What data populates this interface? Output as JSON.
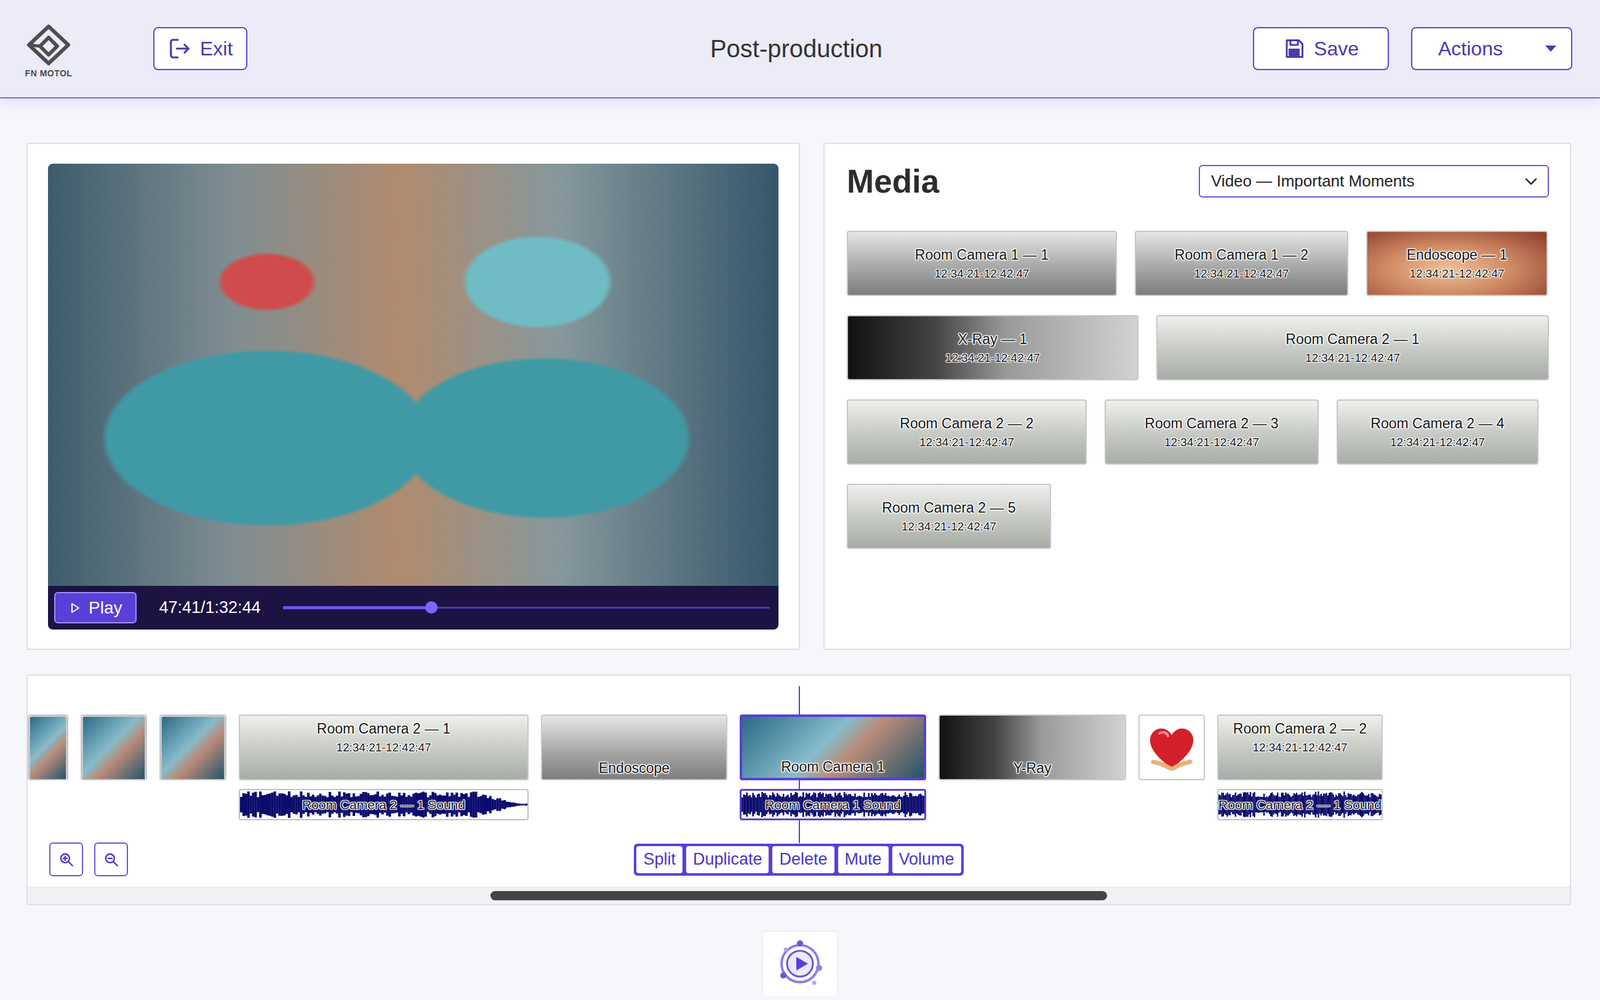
{
  "header": {
    "logo_text": "FN MOTOL",
    "exit": "Exit",
    "title": "Post-production",
    "save": "Save",
    "actions": "Actions"
  },
  "player": {
    "play": "Play",
    "time": "47:41/1:32:44",
    "level": 0.305
  },
  "media": {
    "title": "Media",
    "filter": "Video — Important Moments",
    "rows": [
      [
        {
          "label": "Room Camera 1 — 1",
          "time": "12:34:21-12:42:47"
        },
        {
          "label": "Room Camera 1 — 2",
          "time": "12:34:21-12:42:47"
        },
        {
          "label": "Endoscope — 1",
          "time": "12:34:21-12:42:47"
        }
      ],
      [
        {
          "label": "X-Ray — 1",
          "time": "12:34:21-12:42:47"
        },
        {
          "label": "Room Camera 2 — 1",
          "time": "12:34:21-12:42:47"
        }
      ],
      [
        {
          "label": "Room Camera 2 — 2",
          "time": "12:34:21-12:42:47"
        },
        {
          "label": "Room Camera 2 — 3",
          "time": "12:34:21-12:42:47"
        },
        {
          "label": "Room Camera 2 — 4",
          "time": "12:34:21-12:42:47"
        }
      ],
      [
        {
          "label": "Room Camera 2 — 5",
          "time": "12:34:21-12:42:47"
        }
      ]
    ]
  },
  "timeline": {
    "clips": [
      {
        "kind": "thumb",
        "selected": false
      },
      {
        "kind": "thumb",
        "selected": false
      },
      {
        "kind": "thumb",
        "selected": false
      },
      {
        "kind": "titled",
        "label": "Room Camera 2 — 1",
        "time": "12:34:21-12:42:47",
        "selected": false,
        "audio": {
          "label": "Room Camera 2 — 1 Sound",
          "selected": false
        }
      },
      {
        "kind": "captioned",
        "label": "Endoscope",
        "selected": false
      },
      {
        "kind": "captioned",
        "label": "Room Camera 1",
        "selected": true,
        "audio": {
          "label": "Room Camera 1 Sound",
          "selected": true
        }
      },
      {
        "kind": "captioned",
        "label": "Y-Ray",
        "selected": false
      },
      {
        "kind": "graphic",
        "selected": false
      },
      {
        "kind": "titled",
        "label": "Room Camera 2 — 2",
        "time": "12:34:21-12:42:47",
        "selected": false,
        "audio": {
          "label": "Room Camera 2 — 1 Sound",
          "selected": false
        }
      }
    ],
    "actions": [
      "Split",
      "Duplicate",
      "Delete",
      "Mute",
      "Volume"
    ],
    "scrollbar": {
      "offset": 0.3,
      "level": 0.4
    }
  }
}
